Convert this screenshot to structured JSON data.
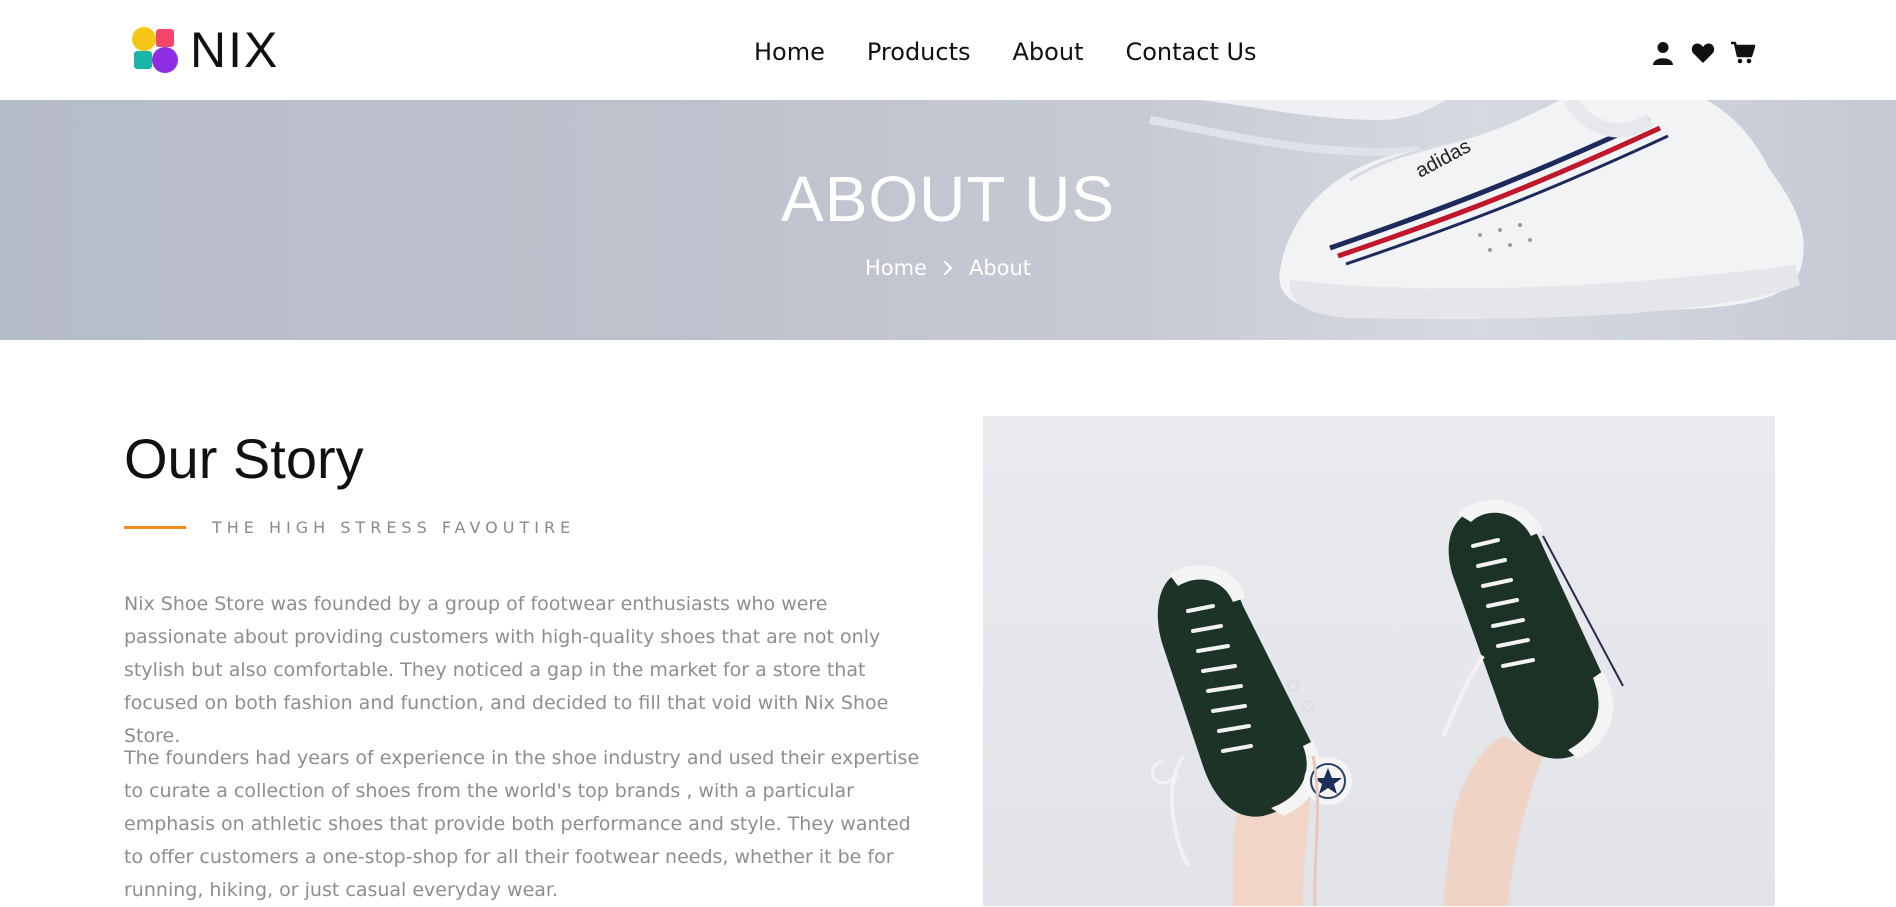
{
  "brand": {
    "name": "NIX"
  },
  "nav": {
    "items": [
      {
        "label": "Home"
      },
      {
        "label": "Products"
      },
      {
        "label": "About"
      },
      {
        "label": "Contact Us"
      }
    ]
  },
  "header_icons": [
    "user-icon",
    "heart-icon",
    "cart-icon"
  ],
  "banner": {
    "title": "ABOUT US",
    "breadcrumb": {
      "home": "Home",
      "current": "About"
    }
  },
  "story": {
    "title": "Our Story",
    "tagline": "THE HIGH STRESS FAVOUTIRE",
    "paragraphs": [
      "Nix Shoe Store was founded by a group of footwear enthusiasts who were passionate about providing customers with high-quality shoes that are not only stylish but also comfortable. They noticed a gap in the market for a store that focused on both fashion and function, and decided to fill that void with Nix Shoe Store.",
      "The founders had years of experience in the shoe industry and used their expertise to curate a collection of shoes from the world's top brands , with a particular emphasis on athletic shoes that provide both performance and style. They wanted to offer customers a one-stop-shop for all their footwear needs, whether it be for running, hiking, or just casual everyday wear."
    ]
  },
  "colors": {
    "accent": "#f28a1e",
    "text_muted": "#8e8e8e",
    "banner_bg": "#bfc3ce"
  }
}
